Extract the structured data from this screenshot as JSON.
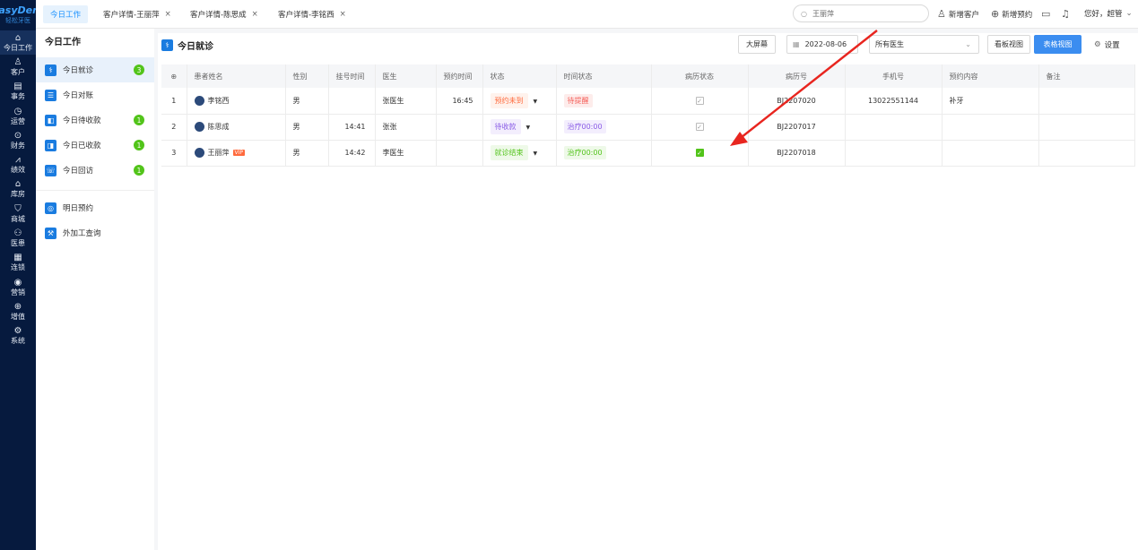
{
  "brand": {
    "name": "EasyDent",
    "sub": "轻松牙医"
  },
  "rail": [
    {
      "icon": "⌂",
      "label": "今日工作",
      "name": "home-icon"
    },
    {
      "icon": "♙",
      "label": "客户",
      "name": "customer-icon"
    },
    {
      "icon": "▤",
      "label": "事务",
      "name": "affairs-icon"
    },
    {
      "icon": "◷",
      "label": "运营",
      "name": "operations-icon"
    },
    {
      "icon": "⊙",
      "label": "财务",
      "name": "finance-icon"
    },
    {
      "icon": "⩘",
      "label": "绩效",
      "name": "performance-icon"
    },
    {
      "icon": "⌂",
      "label": "库房",
      "name": "warehouse-icon"
    },
    {
      "icon": "⛉",
      "label": "商城",
      "name": "mall-icon"
    },
    {
      "icon": "⚇",
      "label": "医患",
      "name": "doctor-patient-icon"
    },
    {
      "icon": "▦",
      "label": "连锁",
      "name": "chain-icon"
    },
    {
      "icon": "◉",
      "label": "营销",
      "name": "marketing-icon"
    },
    {
      "icon": "⊕",
      "label": "增值",
      "name": "value-added-icon"
    },
    {
      "icon": "⚙",
      "label": "系统",
      "name": "system-icon"
    }
  ],
  "tabs": [
    {
      "label": "今日工作",
      "closable": false
    },
    {
      "label": "客户详情-王丽萍",
      "closable": true
    },
    {
      "label": "客户详情-陈思成",
      "closable": true
    },
    {
      "label": "客户详情-李铭西",
      "closable": true
    }
  ],
  "search": {
    "value": "王丽萍",
    "icon": "search-icon"
  },
  "header_actions": {
    "new_customer": "新增客户",
    "new_appointment": "新增预约",
    "greeting": "您好，超管"
  },
  "sidebar": {
    "title": "今日工作",
    "items": [
      {
        "label": "今日就诊",
        "badge": "3",
        "active": true
      },
      {
        "label": "今日对账",
        "badge": ""
      },
      {
        "label": "今日待收款",
        "badge": "1"
      },
      {
        "label": "今日已收款",
        "badge": "1"
      },
      {
        "label": "今日回访",
        "badge": "1"
      },
      {
        "label": "明日预约",
        "badge": ""
      },
      {
        "label": "外加工查询",
        "badge": ""
      }
    ]
  },
  "main": {
    "title": "今日就诊",
    "big_screen": "大屏幕",
    "date": "2022-08-06",
    "doctor_select": "所有医生",
    "kanban_view": "看板视图",
    "table_view": "表格视图",
    "settings": "设置"
  },
  "table": {
    "headers": [
      "",
      "患者姓名",
      "性别",
      "挂号时间",
      "医生",
      "预约时间",
      "状态",
      "时间状态",
      "病历状态",
      "病历号",
      "手机号",
      "预约内容",
      "备注"
    ],
    "rows": [
      {
        "no": "1",
        "name": "李铭西",
        "vip": false,
        "gender": "男",
        "reg_time": "",
        "doctor": "张医生",
        "appt_time": "16:45",
        "status": "预约未到",
        "status_color": "#ff6a3d",
        "status_bg": "#fff2ec",
        "time_status": "待提醒",
        "time_color": "#f5605a",
        "time_bg": "#fdeceb",
        "record_checked": true,
        "record_no": "BJ2207020",
        "phone": "13022551144",
        "appt_content": "补牙",
        "remark": ""
      },
      {
        "no": "2",
        "name": "陈思成",
        "vip": false,
        "gender": "男",
        "reg_time": "14:41",
        "doctor": "张张",
        "appt_time": "",
        "status": "待收款",
        "status_color": "#8a5ce6",
        "status_bg": "#f3eefd",
        "time_status": "治疗00:00",
        "time_color": "#8a5ce6",
        "time_bg": "#f3eefd",
        "record_checked": true,
        "record_no": "BJ2207017",
        "phone": "",
        "appt_content": "",
        "remark": ""
      },
      {
        "no": "3",
        "name": "王丽萍",
        "vip": true,
        "vip_label": "VIP",
        "gender": "男",
        "reg_time": "14:42",
        "doctor": "李医生",
        "appt_time": "",
        "status": "就诊结束",
        "status_color": "#52c41a",
        "status_bg": "#eef9e8",
        "time_status": "治疗00:00",
        "time_color": "#52c41a",
        "time_bg": "#eef9e8",
        "record_checked": true,
        "record_checked_green": true,
        "record_no": "BJ2207018",
        "phone": "",
        "appt_content": "",
        "remark": ""
      }
    ]
  },
  "annotation": {
    "color": "#e8251f"
  }
}
